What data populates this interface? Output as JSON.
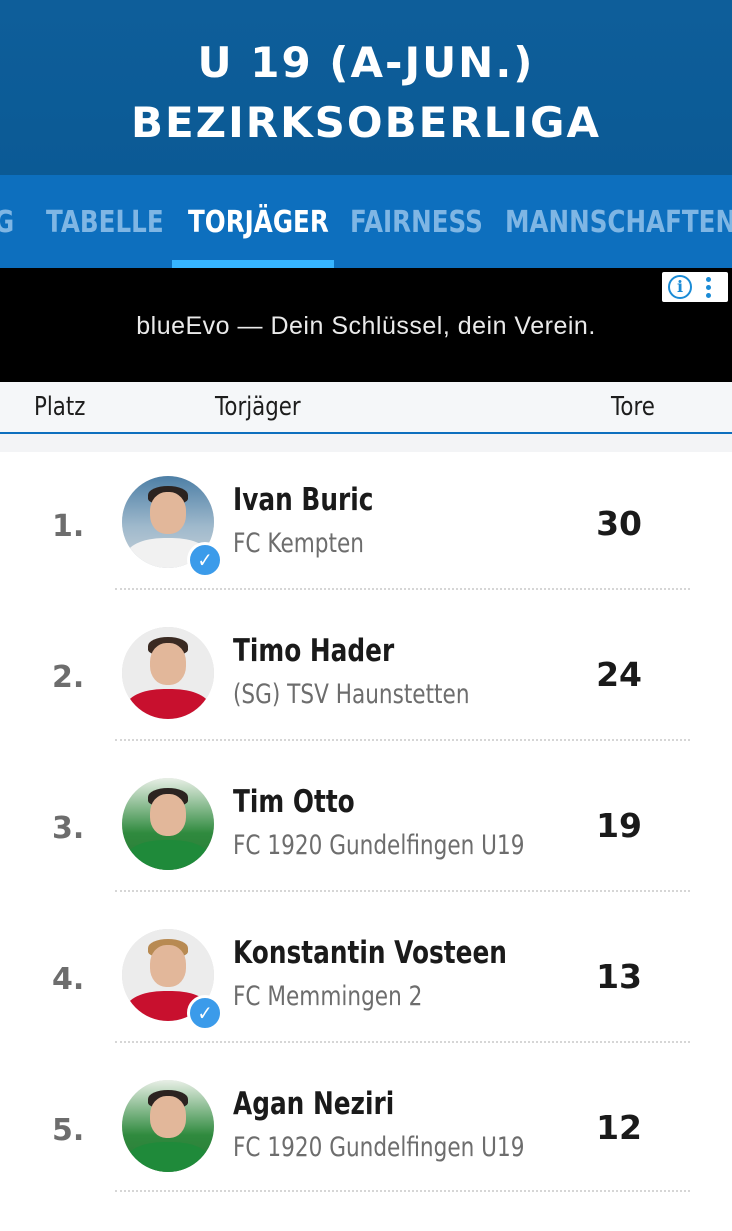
{
  "header": {
    "title_line1": "U 19 (A-JUN.)",
    "title_line2": "BEZIRKSOBERLIGA"
  },
  "tabs": [
    {
      "label": "G",
      "active": false
    },
    {
      "label": "TABELLE",
      "active": false
    },
    {
      "label": "TORJÄGER",
      "active": true
    },
    {
      "label": "FAIRNESS",
      "active": false
    },
    {
      "label": "MANNSCHAFTEN",
      "active": false
    }
  ],
  "ad": {
    "text": "blueEvo — Dein Schlüssel, dein Verein.",
    "info_icon": "info-icon",
    "menu_icon": "vertical-dots-icon"
  },
  "columns": {
    "rank": "Platz",
    "scorer": "Torjäger",
    "goals": "Tore"
  },
  "colors": {
    "header_bg": "#0b5a95",
    "tabs_bg": "#0d6fbe",
    "tab_active_underline": "#37b5ff",
    "verified": "#3b9bea"
  },
  "rows": [
    {
      "rank": "1.",
      "name": "Ivan Buric",
      "club": "FC Kempten",
      "goals": "30",
      "verified": true
    },
    {
      "rank": "2.",
      "name": "Timo Hader",
      "club": "(SG) TSV Haunstetten",
      "goals": "24",
      "verified": false
    },
    {
      "rank": "3.",
      "name": "Tim Otto",
      "club": "FC 1920 Gundelfingen U19",
      "goals": "19",
      "verified": false
    },
    {
      "rank": "4.",
      "name": "Konstantin Vosteen",
      "club": "FC Memmingen 2",
      "goals": "13",
      "verified": true
    },
    {
      "rank": "5.",
      "name": "Agan Neziri",
      "club": "FC 1920 Gundelfingen U19",
      "goals": "12",
      "verified": false
    }
  ]
}
